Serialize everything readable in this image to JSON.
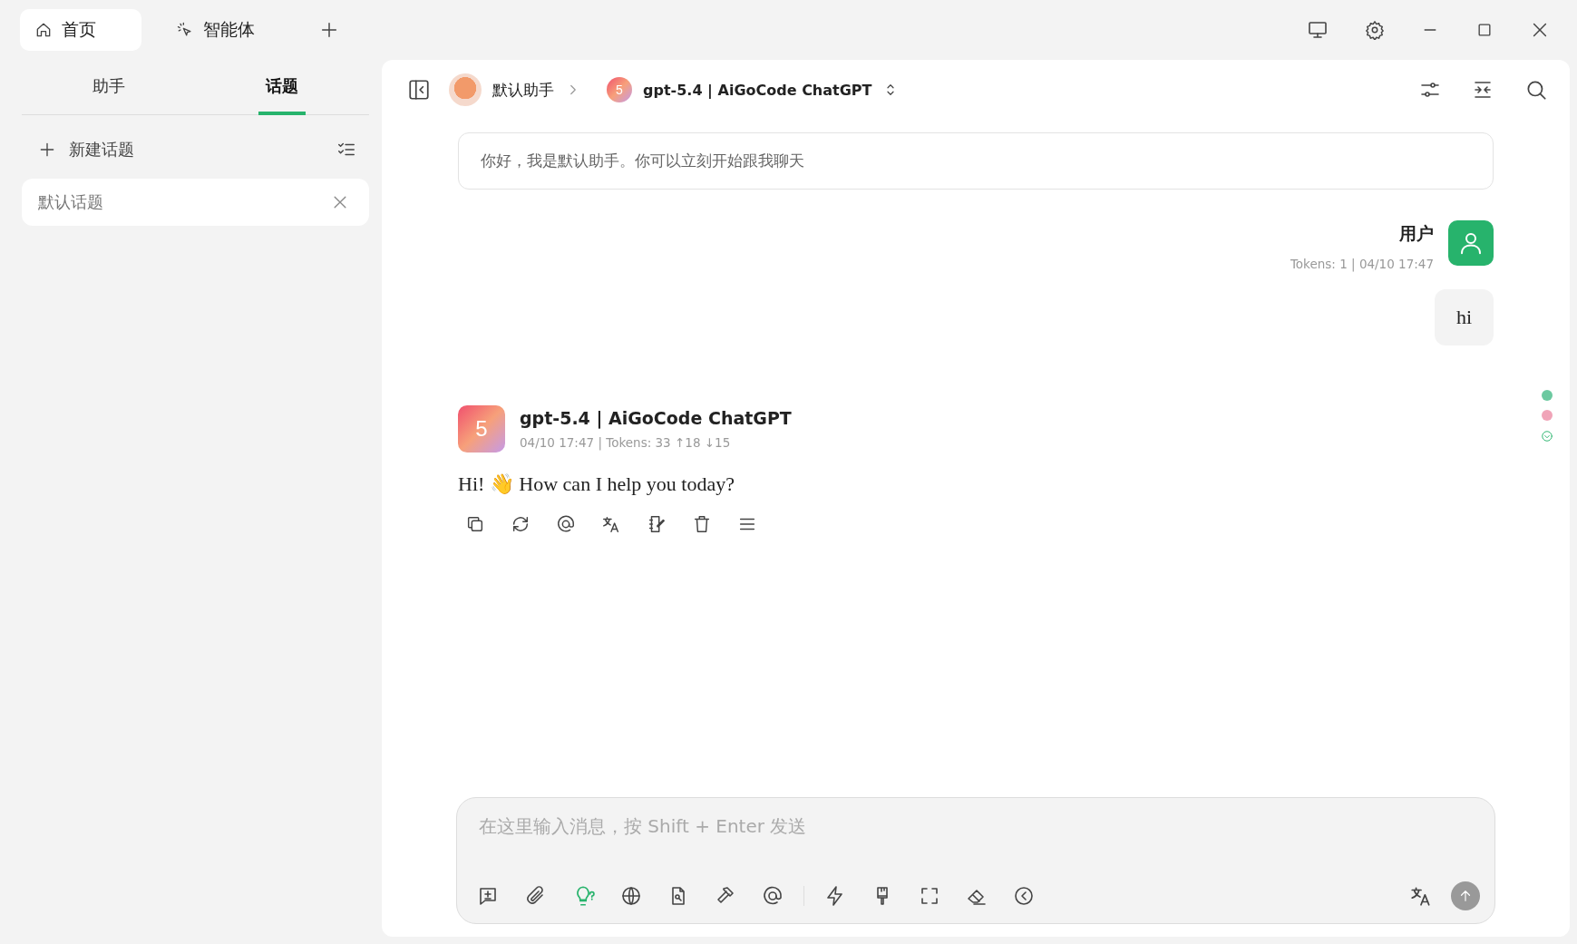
{
  "app_tabs": [
    {
      "label": "首页",
      "selected": true,
      "kind": "home"
    },
    {
      "label": "智能体",
      "selected": false,
      "kind": "agents"
    }
  ],
  "sidebar": {
    "tabs": [
      {
        "label": "助手",
        "selected": false
      },
      {
        "label": "话题",
        "selected": true
      }
    ],
    "new_topic": "新建话题",
    "topics": [
      {
        "label": "默认话题",
        "selected": true
      }
    ]
  },
  "header": {
    "assistant": "默认助手",
    "model_badge": "5",
    "model": "gpt-5.4 | AiGoCode ChatGPT"
  },
  "prompt": "你好，我是默认助手。你可以立刻开始跟我聊天",
  "messages": [
    {
      "kind": "user",
      "name": "用户",
      "meta": "Tokens: 1 | 04/10 17:47",
      "text": "hi"
    },
    {
      "kind": "assistant",
      "badge": "5",
      "name": "gpt-5.4 | AiGoCode ChatGPT",
      "meta": "04/10 17:47 | Tokens: 33 ↑18 ↓15",
      "text": "Hi! 👋 How can I help you today?"
    }
  ],
  "input": {
    "placeholder": "在这里输入消息，按 Shift + Enter 发送",
    "thinking_on": true
  }
}
